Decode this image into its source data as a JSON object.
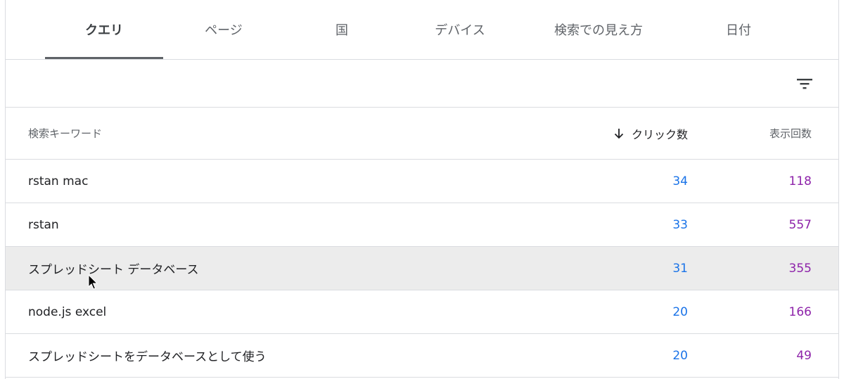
{
  "tabs": [
    {
      "label": "クエリ",
      "active": true
    },
    {
      "label": "ページ",
      "active": false
    },
    {
      "label": "国",
      "active": false
    },
    {
      "label": "デバイス",
      "active": false
    },
    {
      "label": "検索での見え方",
      "active": false
    },
    {
      "label": "日付",
      "active": false
    }
  ],
  "filter": {
    "icon": "filter-icon"
  },
  "table": {
    "headers": {
      "query": "検索キーワード",
      "clicks": "クリック数",
      "impressions": "表示回数",
      "sort_icon": "arrow-down-icon"
    },
    "rows": [
      {
        "query": "rstan mac",
        "clicks": "34",
        "impressions": "118"
      },
      {
        "query": "rstan",
        "clicks": "33",
        "impressions": "557"
      },
      {
        "query": "スプレッドシート データベース",
        "clicks": "31",
        "impressions": "355"
      },
      {
        "query": "node.js excel",
        "clicks": "20",
        "impressions": "166"
      },
      {
        "query": "スプレッドシートをデータベースとして使う",
        "clicks": "20",
        "impressions": "49"
      }
    ]
  },
  "colors": {
    "clicks": "#1a73e8",
    "impressions": "#8e24aa",
    "hover_row": "#ececec"
  }
}
